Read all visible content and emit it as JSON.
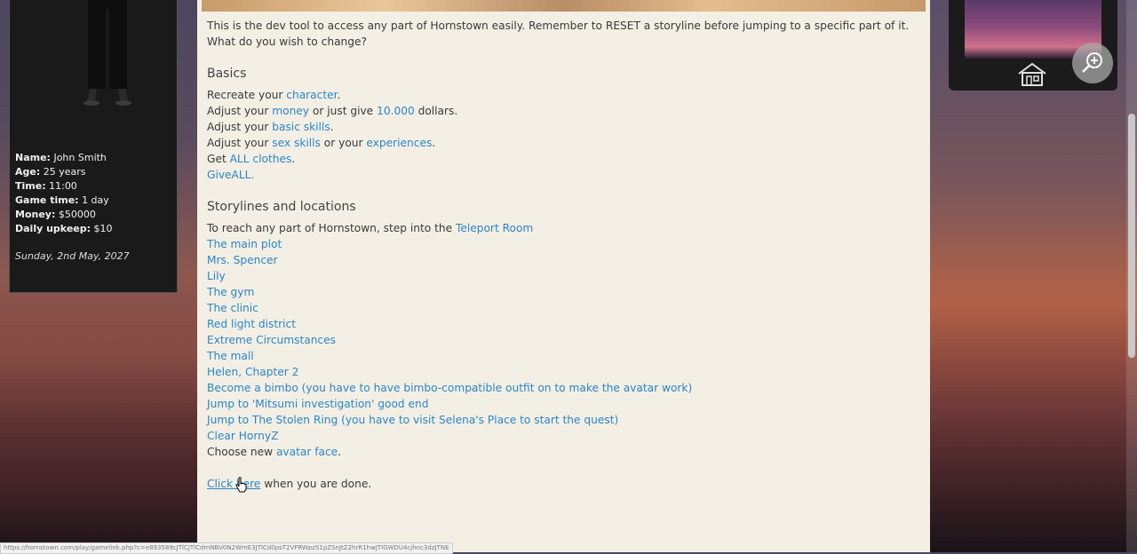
{
  "stats": {
    "rows": [
      {
        "label": "Name:",
        "value": "John Smith"
      },
      {
        "label": "Age:",
        "value": "25 years"
      },
      {
        "label": "Time:",
        "value": "11:00"
      },
      {
        "label": "Game time:",
        "value": "1 day"
      },
      {
        "label": "Money:",
        "value": "$50000"
      },
      {
        "label": "Daily upkeep:",
        "value": "$10"
      }
    ],
    "date": "Sunday, 2nd May, 2027"
  },
  "content": {
    "intro": "This is the dev tool to access any part of Hornstown easily. Remember to RESET a storyline before jumping to a specific part of it. What do you wish to change?",
    "basics_title": "Basics",
    "basics": {
      "l1_pre": "Recreate your ",
      "l1_link": "character",
      "l1_post": ".",
      "l2_pre": "Adjust your ",
      "l2_link": "money",
      "l2_mid": " or just give ",
      "l2_link2": "10.000",
      "l2_post": " dollars.",
      "l3_pre": "Adjust your ",
      "l3_link": "basic skills",
      "l3_post": ".",
      "l4_pre": "Adjust your ",
      "l4_link": "sex skills",
      "l4_mid": " or your ",
      "l4_link2": "experiences",
      "l4_post": ".",
      "l5_pre": "Get ",
      "l5_link": "ALL clothes",
      "l5_post": ".",
      "l6_link": "GiveALL."
    },
    "story_title": "Storylines and locations",
    "teleport_pre": "To reach any part of Hornstown, step into the ",
    "teleport_link": "Teleport Room",
    "story_links": [
      "The main plot",
      "Mrs. Spencer",
      "Lily",
      "The gym",
      "The clinic",
      "Red light district",
      "Extreme Circumstances",
      "The mall",
      "Helen, Chapter 2",
      "Become a bimbo (you have to have bimbo-compatible outfit on to make the avatar work)",
      "Jump to 'Mitsumi investigation' good end",
      "Jump to The Stolen Ring (you have to visit Selena's Place to start the quest)",
      "Clear HornyZ"
    ],
    "face_pre": "Choose new ",
    "face_link": "avatar face",
    "face_post": ".",
    "done_link": "Click here",
    "done_post": " when you are done."
  },
  "status_url": "https://hornstown.com/play/gamelink.php?c=e893589cJTlCJTlCdmNBV0N2WmE3JTlCd0psT2VFRWpzS1pZSnJtZ2hrR1hwJTlGWDU4cjhnc3dzJTNE",
  "colors": {
    "link": "#2a86c9",
    "panel": "#1a1a1a",
    "content_bg": "#f3efe4"
  }
}
